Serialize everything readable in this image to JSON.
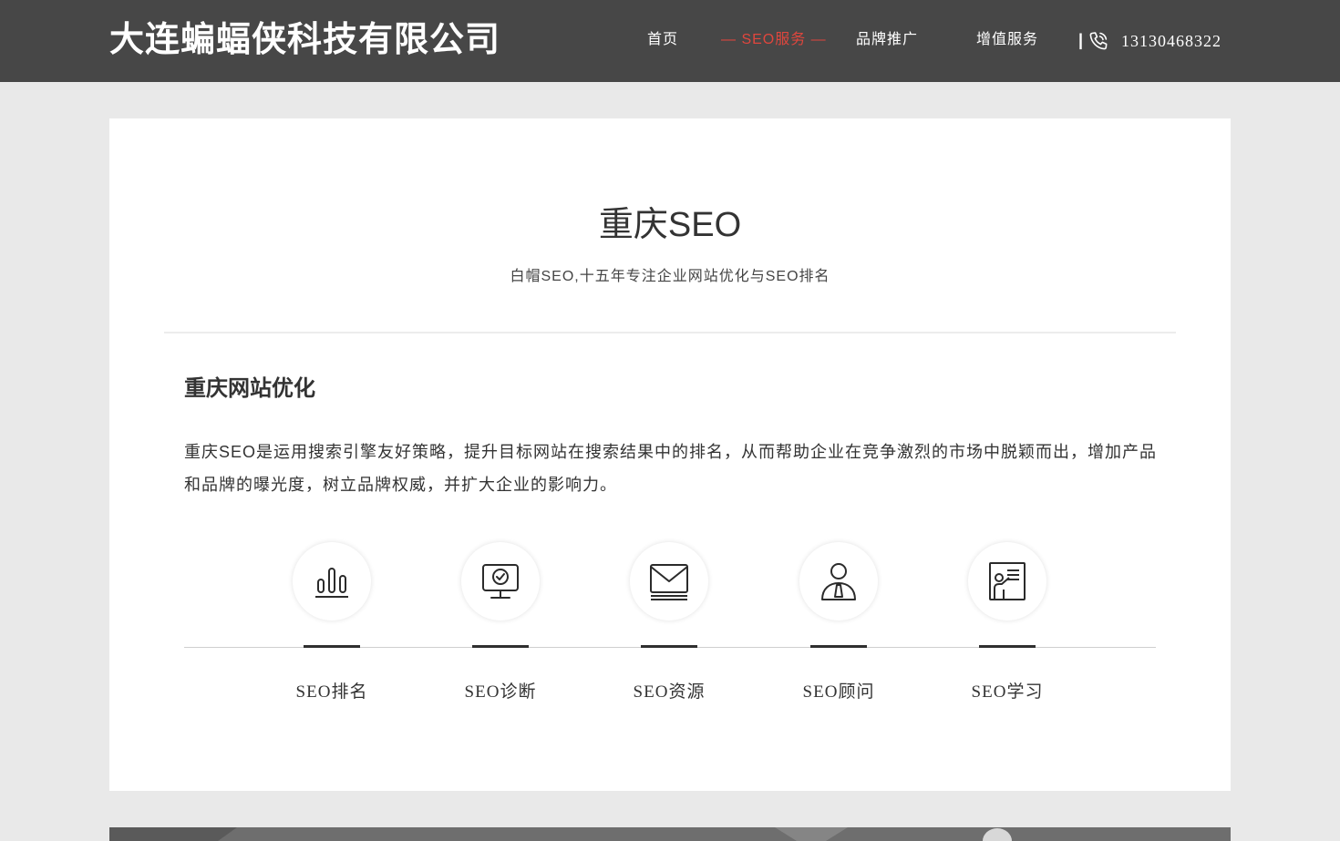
{
  "header": {
    "logo": "大连蝙蝠侠科技有限公司",
    "nav": [
      {
        "label": "首页",
        "active": false
      },
      {
        "label": "— SEO服务 —",
        "active": true
      },
      {
        "label": "品牌推广",
        "active": false
      },
      {
        "label": "增值服务",
        "active": false
      }
    ],
    "separator": "|",
    "phone_icon": "phone-icon",
    "phone": "13130468322",
    "colors": {
      "background": "#474747",
      "active": "#e0463d"
    }
  },
  "main": {
    "title": "重庆SEO",
    "subtitle": "白帽SEO,十五年专注企业网站优化与SEO排名",
    "section": {
      "title": "重庆网站优化",
      "description": "重庆SEO是运用搜索引擎友好策略，提升目标网站在搜索结果中的排名，从而帮助企业在竞争激烈的市场中脱颖而出，增加产品和品牌的曝光度，树立品牌权威，并扩大企业的影响力。"
    },
    "features": [
      {
        "label": "SEO排名",
        "icon": "bar-chart-icon"
      },
      {
        "label": "SEO诊断",
        "icon": "monitor-check-icon"
      },
      {
        "label": "SEO资源",
        "icon": "mail-icon"
      },
      {
        "label": "SEO顾问",
        "icon": "consultant-icon"
      },
      {
        "label": "SEO学习",
        "icon": "presentation-icon"
      }
    ]
  }
}
